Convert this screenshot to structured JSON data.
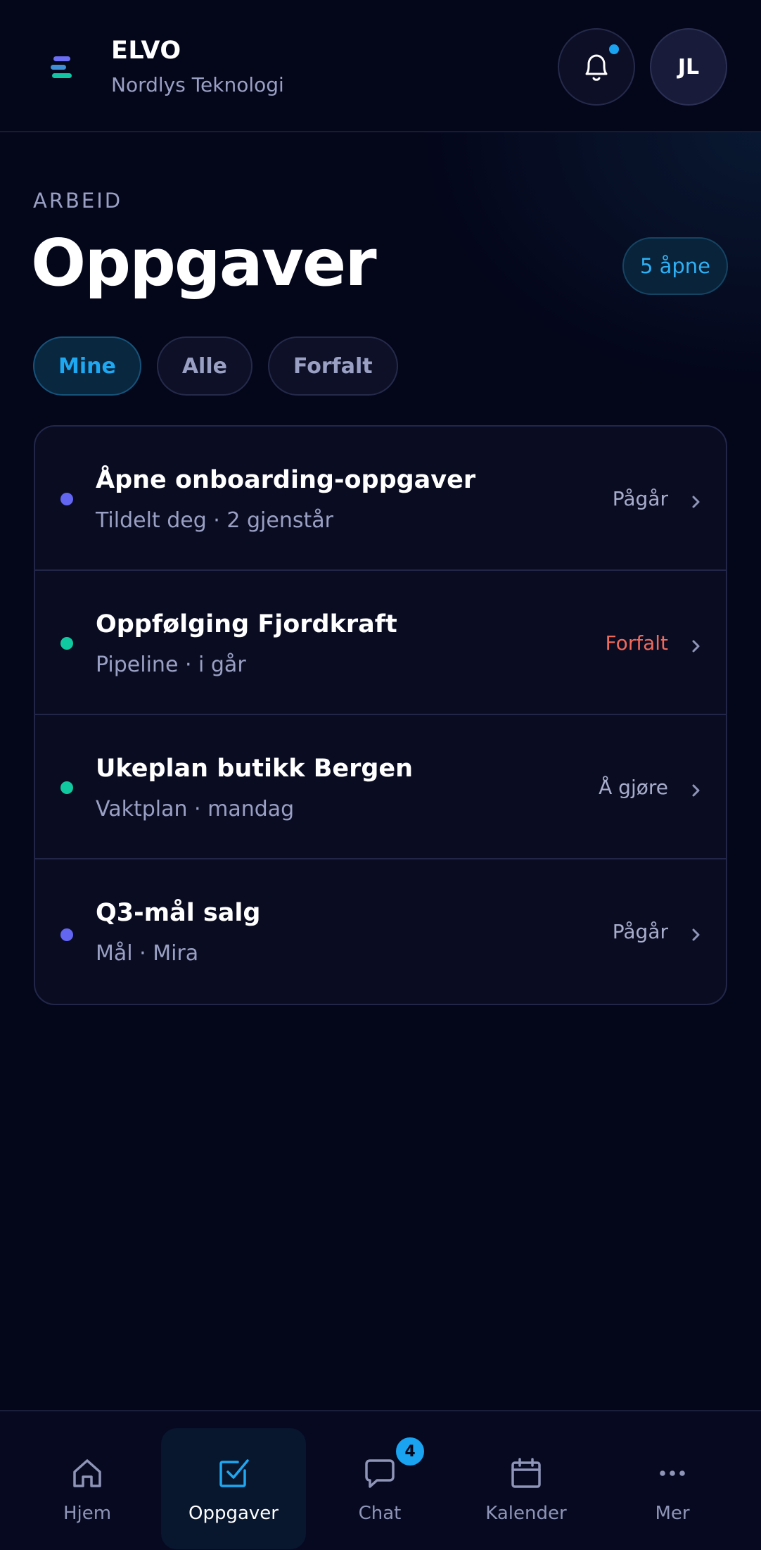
{
  "header": {
    "brand_name": "ELVO",
    "brand_sub": "Nordlys Teknologi",
    "logo_icon": "elvo-logo-icon",
    "notification_icon": "bell-icon",
    "avatar_initials": "JL"
  },
  "title_section": {
    "eyebrow": "ARBEID",
    "title": "Oppgaver",
    "count_label": "5 åpne"
  },
  "filters": [
    {
      "label": "Mine",
      "active": true
    },
    {
      "label": "Alle",
      "active": false
    },
    {
      "label": "Forfalt",
      "active": false
    }
  ],
  "tasks": [
    {
      "title": "Åpne onboarding-oppgaver",
      "sub": "Tildelt deg · 2 gjenstår",
      "status": "Pågår",
      "dot_color": "#6366f1",
      "status_color": "#a8adcc"
    },
    {
      "title": "Oppfølging Fjordkraft",
      "sub": "Pipeline · i går",
      "status": "Forfalt",
      "dot_color": "#10c9a0",
      "status_color": "#f06a5c"
    },
    {
      "title": "Ukeplan butikk Bergen",
      "sub": "Vaktplan · mandag",
      "status": "Å gjøre",
      "dot_color": "#10c9a0",
      "status_color": "#a8adcc"
    },
    {
      "title": "Q3-mål salg",
      "sub": "Mål · Mira",
      "status": "Pågår",
      "dot_color": "#6366f1",
      "status_color": "#a8adcc"
    }
  ],
  "nav": [
    {
      "label": "Hjem",
      "icon": "home-icon",
      "active": false
    },
    {
      "label": "Oppgaver",
      "icon": "checkbox-icon",
      "active": true
    },
    {
      "label": "Chat",
      "icon": "chat-icon",
      "active": false,
      "badge": "4"
    },
    {
      "label": "Kalender",
      "icon": "calendar-icon",
      "active": false
    },
    {
      "label": "Mer",
      "icon": "more-icon",
      "active": false
    }
  ],
  "colors": {
    "accent": "#1aa3f0",
    "background": "#04061a",
    "card": "#0a0c22",
    "danger": "#f06a5c",
    "indigo": "#6366f1",
    "teal": "#10c9a0"
  }
}
